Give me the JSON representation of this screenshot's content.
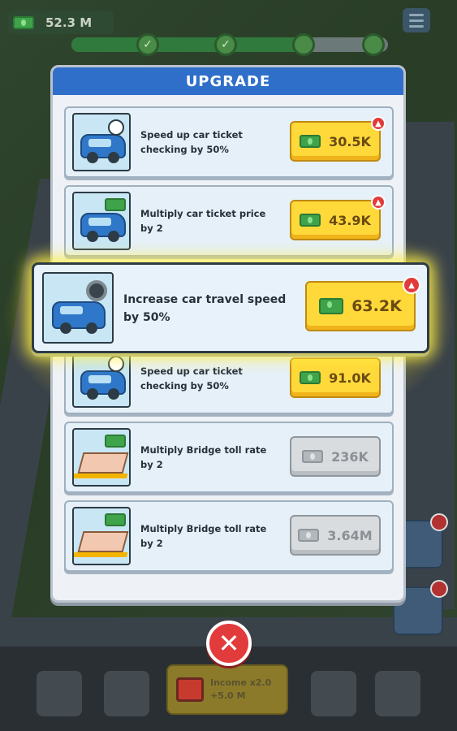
{
  "hud": {
    "money": "52.3 M",
    "progress_fraction": 0.72,
    "milestones": [
      "✓",
      "✓",
      "",
      ""
    ]
  },
  "panel": {
    "title": "UPGRADE",
    "rows": [
      {
        "label": "Speed up car ticket checking by 50%",
        "price": "30.5K",
        "style": "gold",
        "icon": "car-clock-icon"
      },
      {
        "label": "Multiply car ticket price by 2",
        "price": "43.9K",
        "style": "gold",
        "icon": "car-ticket-icon"
      },
      {
        "label": "Speed up car ticket checking by 50%",
        "price": "91.0K",
        "style": "gold",
        "icon": "car-clock-icon"
      },
      {
        "label": "Multiply Bridge toll rate by 2",
        "price": "236K",
        "style": "grey",
        "icon": "bridge-toll-icon"
      },
      {
        "label": "Multiply Bridge toll rate by 2",
        "price": "3.64M",
        "style": "grey",
        "icon": "bridge-toll-icon"
      }
    ]
  },
  "highlight": {
    "label": "Increase car travel speed by 50%",
    "price": "63.2K",
    "icon": "car-tire-icon"
  },
  "bottom_bar": {
    "income_label": "Income x2.0",
    "income_sub": "+5.0 M"
  },
  "colors": {
    "header_blue": "#2f6fc9",
    "gold_button": "#ffd93a",
    "grey_button": "#d9dcdf",
    "close_red": "#e23b3b"
  }
}
